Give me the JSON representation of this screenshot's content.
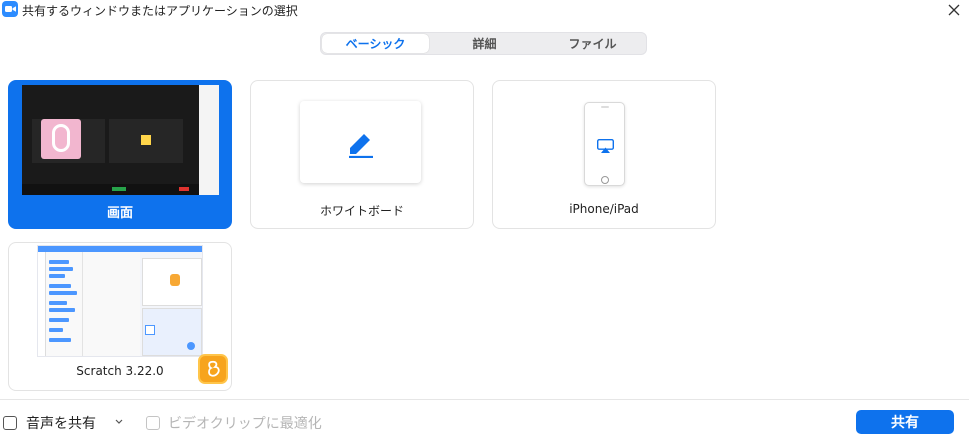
{
  "window": {
    "title": "共有するウィンドウまたはアプリケーションの選択",
    "app_icon": "zoom-camera-icon",
    "close_icon": "close-icon"
  },
  "tabs": [
    {
      "label": "ベーシック",
      "selected": true
    },
    {
      "label": "詳細",
      "selected": false
    },
    {
      "label": "ファイル",
      "selected": false
    }
  ],
  "options": [
    {
      "label": "画面",
      "selected": true,
      "icon": "screen-thumbnail"
    },
    {
      "label": "ホワイトボード",
      "selected": false,
      "icon": "pen-icon"
    },
    {
      "label": "iPhone/iPad",
      "selected": false,
      "icon": "airplay-icon"
    },
    {
      "label": "Scratch 3.22.0",
      "selected": false,
      "icon": "scratch-app-icon"
    }
  ],
  "footer": {
    "share_audio_label": "音声を共有",
    "share_audio_checked": false,
    "optimize_video_label": "ビデオクリップに最適化",
    "optimize_video_checked": false,
    "optimize_video_enabled": false,
    "share_button": "共有"
  },
  "colors": {
    "accent": "#0E72ED",
    "card_border": "#E3E3E3",
    "disabled_text": "#B5B5B5"
  }
}
